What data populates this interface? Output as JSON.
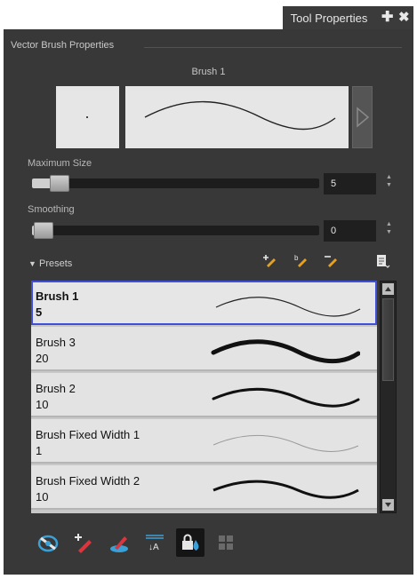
{
  "tab": {
    "title": "Tool Properties",
    "add_icon": "plus-icon",
    "close_icon": "close-icon"
  },
  "section": {
    "title": "Vector Brush Properties"
  },
  "brush": {
    "name": "Brush 1"
  },
  "max_size": {
    "label": "Maximum Size",
    "value": "5",
    "slider_fraction": 0.06
  },
  "smoothing": {
    "label": "Smoothing",
    "value": "0",
    "slider_fraction": 0.0
  },
  "presets": {
    "label": "Presets",
    "icons": [
      "new-brush-preset-icon",
      "rename-brush-preset-icon",
      "delete-brush-preset-icon",
      "preset-menu-icon"
    ],
    "items": [
      {
        "name": "Brush 1",
        "size": "5",
        "selected": true
      },
      {
        "name": "Brush 3",
        "size": "20",
        "selected": false
      },
      {
        "name": "Brush 2",
        "size": "10",
        "selected": false
      },
      {
        "name": "Brush Fixed Width 1",
        "size": "1",
        "selected": false
      },
      {
        "name": "Brush Fixed Width 2",
        "size": "10",
        "selected": false
      }
    ]
  },
  "bottom_toolbar": {
    "icons": [
      "auto-flatten-icon",
      "create-colour-art-icon",
      "draw-behind-icon",
      "stroke-text-icon",
      "lock-colour-icon",
      "auto-gap-close-icon"
    ],
    "active": "lock-colour-icon"
  },
  "colors": {
    "accent": "#3f4fd8",
    "panel": "#383838",
    "field": "#1f1f1f",
    "orange": "#e5a126",
    "red": "#d9363e",
    "blue": "#3aa0d8"
  }
}
